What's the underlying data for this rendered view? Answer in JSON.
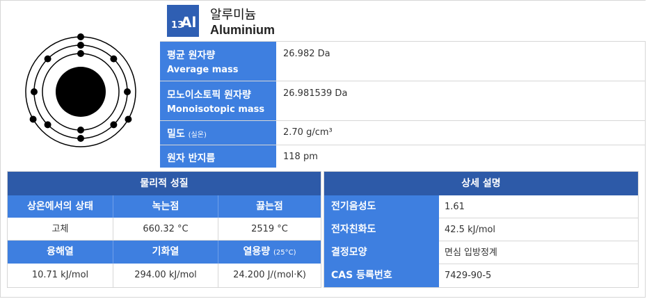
{
  "element": {
    "atomic_number": "13",
    "symbol": "Al",
    "name_ko": "알루미늄",
    "name_en": "Aluminium",
    "electron_shells": [
      2,
      8,
      3
    ]
  },
  "properties": [
    {
      "label": "평균 원자량",
      "sublabel": "Average mass",
      "value": "26.982 Da"
    },
    {
      "label": "모노이소토픽 원자량",
      "sublabel": "Monoisotopic mass",
      "value": "26.981539 Da"
    },
    {
      "label": "밀도",
      "label_note": "(실온)",
      "value": "2.70 g/cm³"
    },
    {
      "label": "원자 반지름",
      "value": "118 pm"
    }
  ],
  "physical": {
    "title": "물리적 성질",
    "headers1": [
      "상온에서의 상태",
      "녹는점",
      "끓는점"
    ],
    "values1": [
      "고체",
      "660.32 °C",
      "2519 °C"
    ],
    "headers2": [
      "융해열",
      "기화열",
      "열용량"
    ],
    "headers2_note": "(25°C)",
    "values2": [
      "10.71 kJ/mol",
      "294.00 kJ/mol",
      "24.200 J/(mol·K)"
    ]
  },
  "details": {
    "title": "상세 설명",
    "rows": [
      {
        "label": "전기음성도",
        "value": "1.61"
      },
      {
        "label": "전자친화도",
        "value": "42.5 kJ/mol"
      },
      {
        "label": "결정모양",
        "value": "면심 입방정계"
      },
      {
        "label": "CAS 등록번호",
        "value": "7429-90-5"
      }
    ]
  },
  "colors": {
    "label_blue": "#3e7fe0",
    "header_blue": "#2d5aa8",
    "badge_blue": "#2f5fb3",
    "electron": "#000000"
  }
}
